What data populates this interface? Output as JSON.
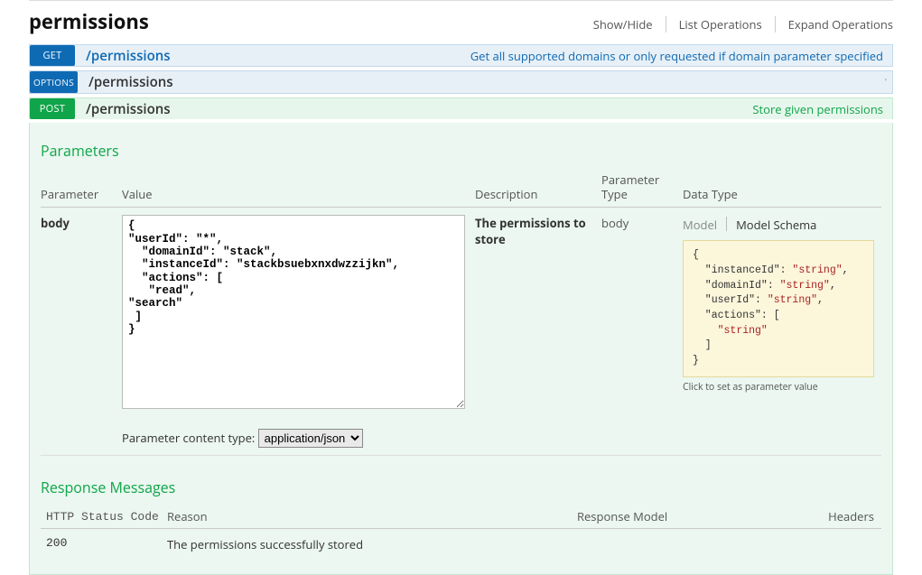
{
  "api": {
    "title": "permissions",
    "actions": {
      "show_hide": "Show/Hide",
      "list_ops": "List Operations",
      "expand_ops": "Expand Operations"
    }
  },
  "ops": {
    "get": {
      "method": "GET",
      "path": "/permissions",
      "desc": "Get all supported domains or only requested if domain parameter specified"
    },
    "options": {
      "method": "OPTIONS",
      "path": "/permissions",
      "badge": "'"
    },
    "post": {
      "method": "POST",
      "path": "/permissions",
      "desc": "Store given permissions"
    }
  },
  "parameters": {
    "title": "Parameters",
    "headers": {
      "parameter": "Parameter",
      "value": "Value",
      "description": "Description",
      "ptype": "Parameter Type",
      "dtype": "Data Type"
    },
    "row": {
      "name": "body",
      "value": "{\n\"userId\": \"*\",\n  \"domainId\": \"stack\",\n  \"instanceId\": \"stackbsuebxnxdwzzijkn\",\n  \"actions\": [\n   \"read\",\n\"search\"\n ]\n}",
      "description": "The permissions to store",
      "ptype": "body"
    },
    "tabs": {
      "model": "Model",
      "schema": "Model Schema"
    },
    "schema_hint": "Click to set as parameter value",
    "content_type_label": "Parameter content type: ",
    "content_type": "application/json"
  },
  "responses": {
    "title": "Response Messages",
    "headers": {
      "code": "HTTP Status Code",
      "reason": "Reason",
      "model": "Response Model",
      "headers": "Headers"
    },
    "row": {
      "code": "200",
      "reason": "The permissions successfully stored"
    }
  },
  "chart_data": {
    "type": "table",
    "title": "Model Schema",
    "schema": {
      "instanceId": "string",
      "domainId": "string",
      "userId": "string",
      "actions": [
        "string"
      ]
    }
  }
}
